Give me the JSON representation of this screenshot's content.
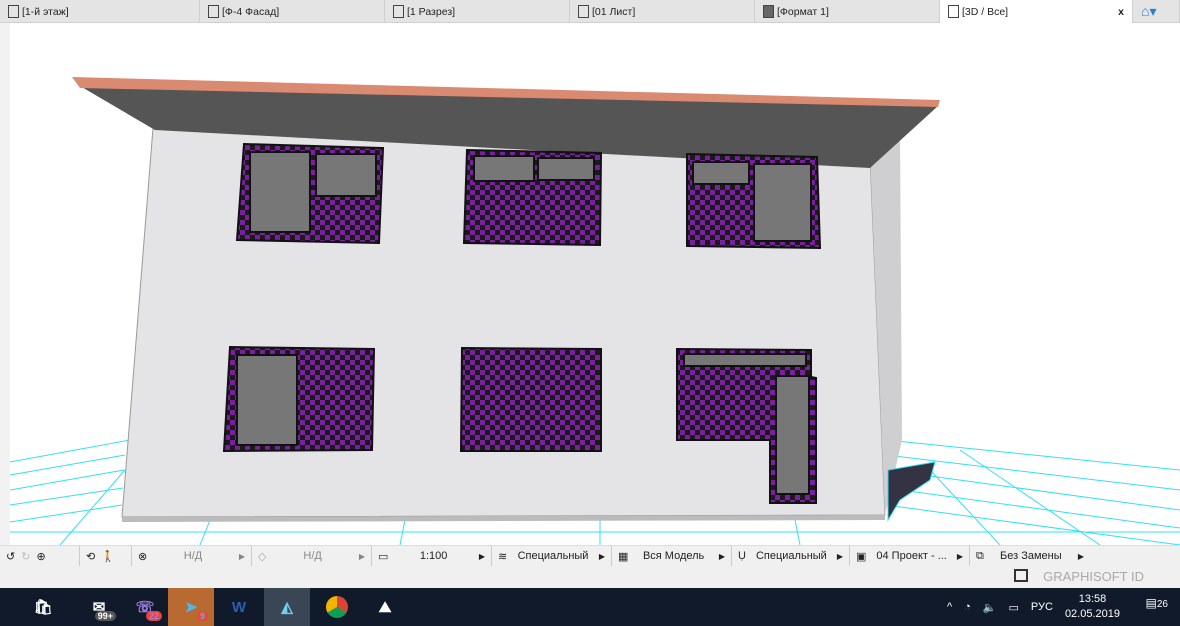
{
  "tabs": [
    {
      "label": "[1-й этаж]",
      "icon": "floor-plan-icon"
    },
    {
      "label": "[Ф-4 Фасад]",
      "icon": "elevation-icon"
    },
    {
      "label": "[1 Разрез]",
      "icon": "section-icon"
    },
    {
      "label": "[01 Лист]",
      "icon": "layout-icon"
    },
    {
      "label": "[Формат 1]",
      "icon": "master-icon"
    },
    {
      "label": "[3D / Все]",
      "icon": "3d-icon",
      "active": true
    }
  ],
  "close_label": "x",
  "toolbar": {
    "nd1": "Н/Д",
    "nd2": "Н/Д",
    "scale": "1:100",
    "layers": "Специальный",
    "model": "Вся Модель",
    "pen": "Специальный",
    "view": "04 Проект - ...",
    "override": "Без Замены"
  },
  "status": {
    "graphisoft_id": "GRAPHISOFT ID"
  },
  "taskbar": {
    "mail_badge": "99+",
    "viber_badge": "22",
    "telegram_badge": "9",
    "language": "РУС",
    "time": "13:58",
    "date": "02.05.2019",
    "notifications": "26"
  },
  "colors": {
    "checker": "#7a1fa0",
    "grid": "#33e0f0",
    "roof": "#d98a70",
    "wall": "#e4e4e6"
  }
}
